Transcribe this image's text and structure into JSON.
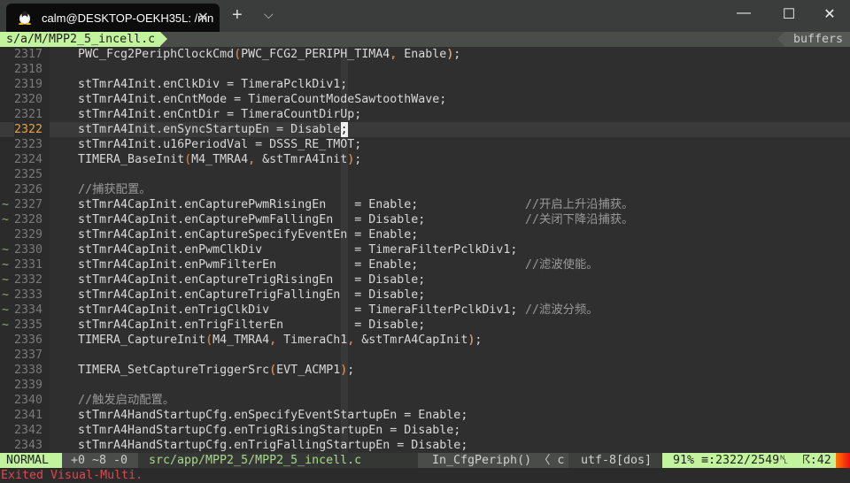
{
  "window": {
    "tab_title": "calm@DESKTOP-OEKH35L: /mn",
    "new_tab": "+",
    "dropdown": "⌵",
    "minimize": "—",
    "maximize": "☐",
    "close": "✕",
    "tab_close": "✕"
  },
  "tabline": {
    "file": "s/a/M/MPP2_5_incell.c",
    "buffers": "buffers"
  },
  "editor": {
    "current_line": 2322,
    "lines": [
      {
        "n": "2317",
        "s": "",
        "t": "    PWC_Fcg2PeriphClockCmd(PWC_FCG2_PERIPH_TIMA4, Enable);"
      },
      {
        "n": "2318",
        "s": "",
        "t": ""
      },
      {
        "n": "2319",
        "s": "",
        "t": "    stTmrA4Init.enClkDiv = TimeraPclkDiv1;"
      },
      {
        "n": "2320",
        "s": "",
        "t": "    stTmrA4Init.enCntMode = TimeraCountModeSawtoothWave;"
      },
      {
        "n": "2321",
        "s": "",
        "t": "    stTmrA4Init.enCntDir = TimeraCountDirUp;"
      },
      {
        "n": "2322",
        "s": "",
        "t": "    stTmrA4Init.enSyncStartupEn = Disable;"
      },
      {
        "n": "2323",
        "s": "",
        "t": "    stTmrA4Init.u16PeriodVal = DSSS_RE_TMOT;"
      },
      {
        "n": "2324",
        "s": "",
        "t": "    TIMERA_BaseInit(M4_TMRA4, &stTmrA4Init);"
      },
      {
        "n": "2325",
        "s": "",
        "t": ""
      },
      {
        "n": "2326",
        "s": "",
        "t": "    //捕获配置。"
      },
      {
        "n": "2327",
        "s": "~",
        "t": "    stTmrA4CapInit.enCapturePwmRisingEn    = Enable;               //开启上升沿捕获。"
      },
      {
        "n": "2328",
        "s": "~",
        "t": "    stTmrA4CapInit.enCapturePwmFallingEn   = Disable;              //关闭下降沿捕获。"
      },
      {
        "n": "2329",
        "s": "",
        "t": "    stTmrA4CapInit.enCaptureSpecifyEventEn = Enable;"
      },
      {
        "n": "2330",
        "s": "~",
        "t": "    stTmrA4CapInit.enPwmClkDiv             = TimeraFilterPclkDiv1;"
      },
      {
        "n": "2331",
        "s": "~",
        "t": "    stTmrA4CapInit.enPwmFilterEn           = Enable;               //滤波使能。"
      },
      {
        "n": "2332",
        "s": "~",
        "t": "    stTmrA4CapInit.enCaptureTrigRisingEn   = Disable;"
      },
      {
        "n": "2333",
        "s": "~",
        "t": "    stTmrA4CapInit.enCaptureTrigFallingEn  = Disable;"
      },
      {
        "n": "2334",
        "s": "~",
        "t": "    stTmrA4CapInit.enTrigClkDiv            = TimeraFilterPclkDiv1; //滤波分频。"
      },
      {
        "n": "2335",
        "s": "~",
        "t": "    stTmrA4CapInit.enTrigFilterEn          = Disable;"
      },
      {
        "n": "2336",
        "s": "",
        "t": "    TIMERA_CaptureInit(M4_TMRA4, TimeraCh1, &stTmrA4CapInit);"
      },
      {
        "n": "2337",
        "s": "",
        "t": ""
      },
      {
        "n": "2338",
        "s": "",
        "t": "    TIMERA_SetCaptureTriggerSrc(EVT_ACMP1);"
      },
      {
        "n": "2339",
        "s": "",
        "t": ""
      },
      {
        "n": "2340",
        "s": "",
        "t": "    //触发启动配置。"
      },
      {
        "n": "2341",
        "s": "",
        "t": "    stTmrA4HandStartupCfg.enSpecifyEventStartupEn = Enable;"
      },
      {
        "n": "2342",
        "s": "",
        "t": "    stTmrA4HandStartupCfg.enTrigRisingStartupEn = Disable;"
      },
      {
        "n": "2343",
        "s": "",
        "t": "    stTmrA4HandStartupCfg.enTrigFallingStartupEn = Disable;"
      }
    ]
  },
  "statusline": {
    "mode": "NORMAL",
    "hunks": "+0 ~8 -0",
    "path": "src/app/MPP2_5/MPP2_5_incell.c",
    "function": "In_CfgPeriph() 〈 c",
    "encoding": "utf-8[dos]",
    "position": "91% ≡:2322/2549␤  ☈:42",
    "percent": 91
  },
  "cmdline": {
    "message": "Exited Visual-Multi."
  },
  "colors": {
    "mode_bg": "#c2f39d",
    "accent_orange": "#c8702a",
    "error_red": "#e0484e"
  }
}
